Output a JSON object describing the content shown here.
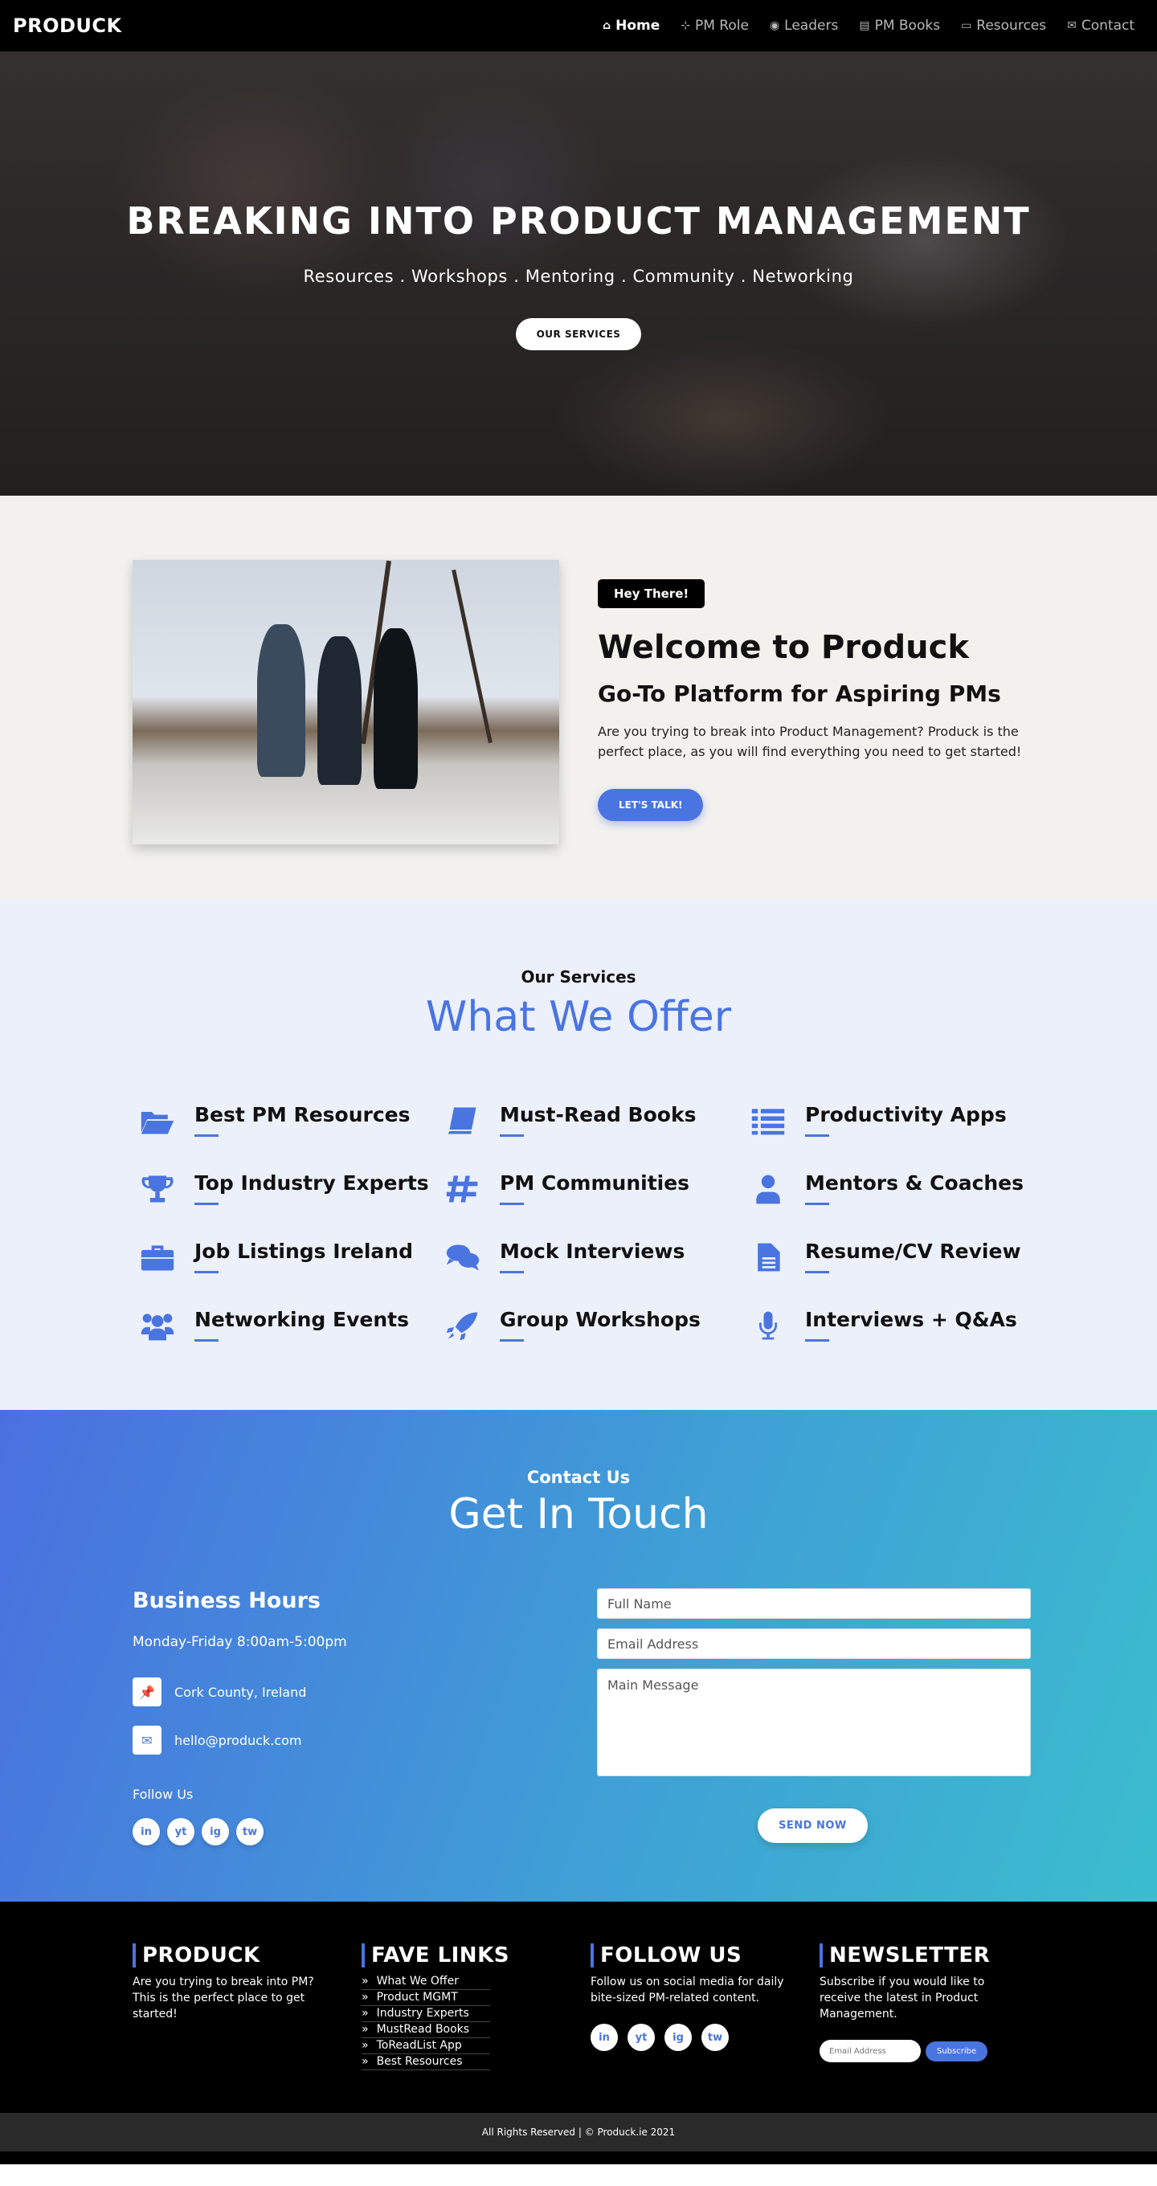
{
  "nav": {
    "brand": "PRODUCK",
    "items": [
      {
        "label": "Home",
        "icon": "home-icon"
      },
      {
        "label": "PM Role",
        "icon": "sitemap-icon"
      },
      {
        "label": "Leaders",
        "icon": "user-circle-icon"
      },
      {
        "label": "PM Books",
        "icon": "book-icon"
      },
      {
        "label": "Resources",
        "icon": "folder-open-icon"
      },
      {
        "label": "Contact",
        "icon": "envelope-icon"
      }
    ]
  },
  "hero": {
    "title": "BREAKING INTO PRODUCT MANAGEMENT",
    "tagline": "Resources . Workshops . Mentoring . Community . Networking",
    "button": "OUR SERVICES"
  },
  "welcome": {
    "badge": "Hey There!",
    "title": "Welcome to Produck",
    "subtitle": "Go-To Platform for Aspiring PMs",
    "body": "Are you trying to break into Product Management? Produck is the perfect place, as you will find everything you need to get started!",
    "button": "LET'S TALK!"
  },
  "services": {
    "kicker": "Our Services",
    "title": "What We Offer",
    "items": [
      {
        "label": "Best PM Resources",
        "icon": "folder-open-icon"
      },
      {
        "label": "Must-Read Books",
        "icon": "book-icon"
      },
      {
        "label": "Productivity Apps",
        "icon": "list-icon"
      },
      {
        "label": "Top Industry Experts",
        "icon": "trophy-icon"
      },
      {
        "label": "PM Communities",
        "icon": "hashtag-icon"
      },
      {
        "label": "Mentors & Coaches",
        "icon": "user-icon"
      },
      {
        "label": "Job Listings Ireland",
        "icon": "briefcase-icon"
      },
      {
        "label": "Mock Interviews",
        "icon": "comments-icon"
      },
      {
        "label": "Resume/CV Review",
        "icon": "file-icon"
      },
      {
        "label": "Networking Events",
        "icon": "users-icon"
      },
      {
        "label": "Group Workshops",
        "icon": "rocket-icon"
      },
      {
        "label": "Interviews + Q&As",
        "icon": "microphone-icon"
      }
    ]
  },
  "contact": {
    "kicker": "Contact Us",
    "title": "Get In Touch",
    "hours_title": "Business Hours",
    "hours": "Monday-Friday 8:00am-5:00pm",
    "location": "Cork County, Ireland",
    "email": "hello@produck.com",
    "follow": "Follow Us",
    "socials": [
      "in",
      "yt",
      "ig",
      "tw"
    ],
    "form": {
      "name_placeholder": "Full Name",
      "email_placeholder": "Email Address",
      "message_placeholder": "Main Message",
      "send": "SEND NOW"
    }
  },
  "footer": {
    "col1": {
      "title": "PRODUCK",
      "text": "Are you trying to break into PM? This is the perfect place to get started!"
    },
    "col2": {
      "title": "FAVE LINKS",
      "links": [
        "What We Offer",
        "Product MGMT",
        "Industry Experts",
        "MustRead Books",
        "ToReadList App",
        "Best Resources"
      ]
    },
    "col3": {
      "title": "FOLLOW US",
      "text": "Follow us on social media for daily bite-sized PM-related content."
    },
    "col4": {
      "title": "NEWSLETTER",
      "text": "Subscribe if you would like to receive the latest in Product Management.",
      "placeholder": "Email Address",
      "button": "Subscribe"
    },
    "copyright": "All Rights Reserved | © Produck.ie 2021"
  },
  "colors": {
    "accent": "#4a74e0",
    "nav_bg": "#000000",
    "welcome_bg": "#f2f1ee",
    "services_bg": "#ebf0fa"
  }
}
